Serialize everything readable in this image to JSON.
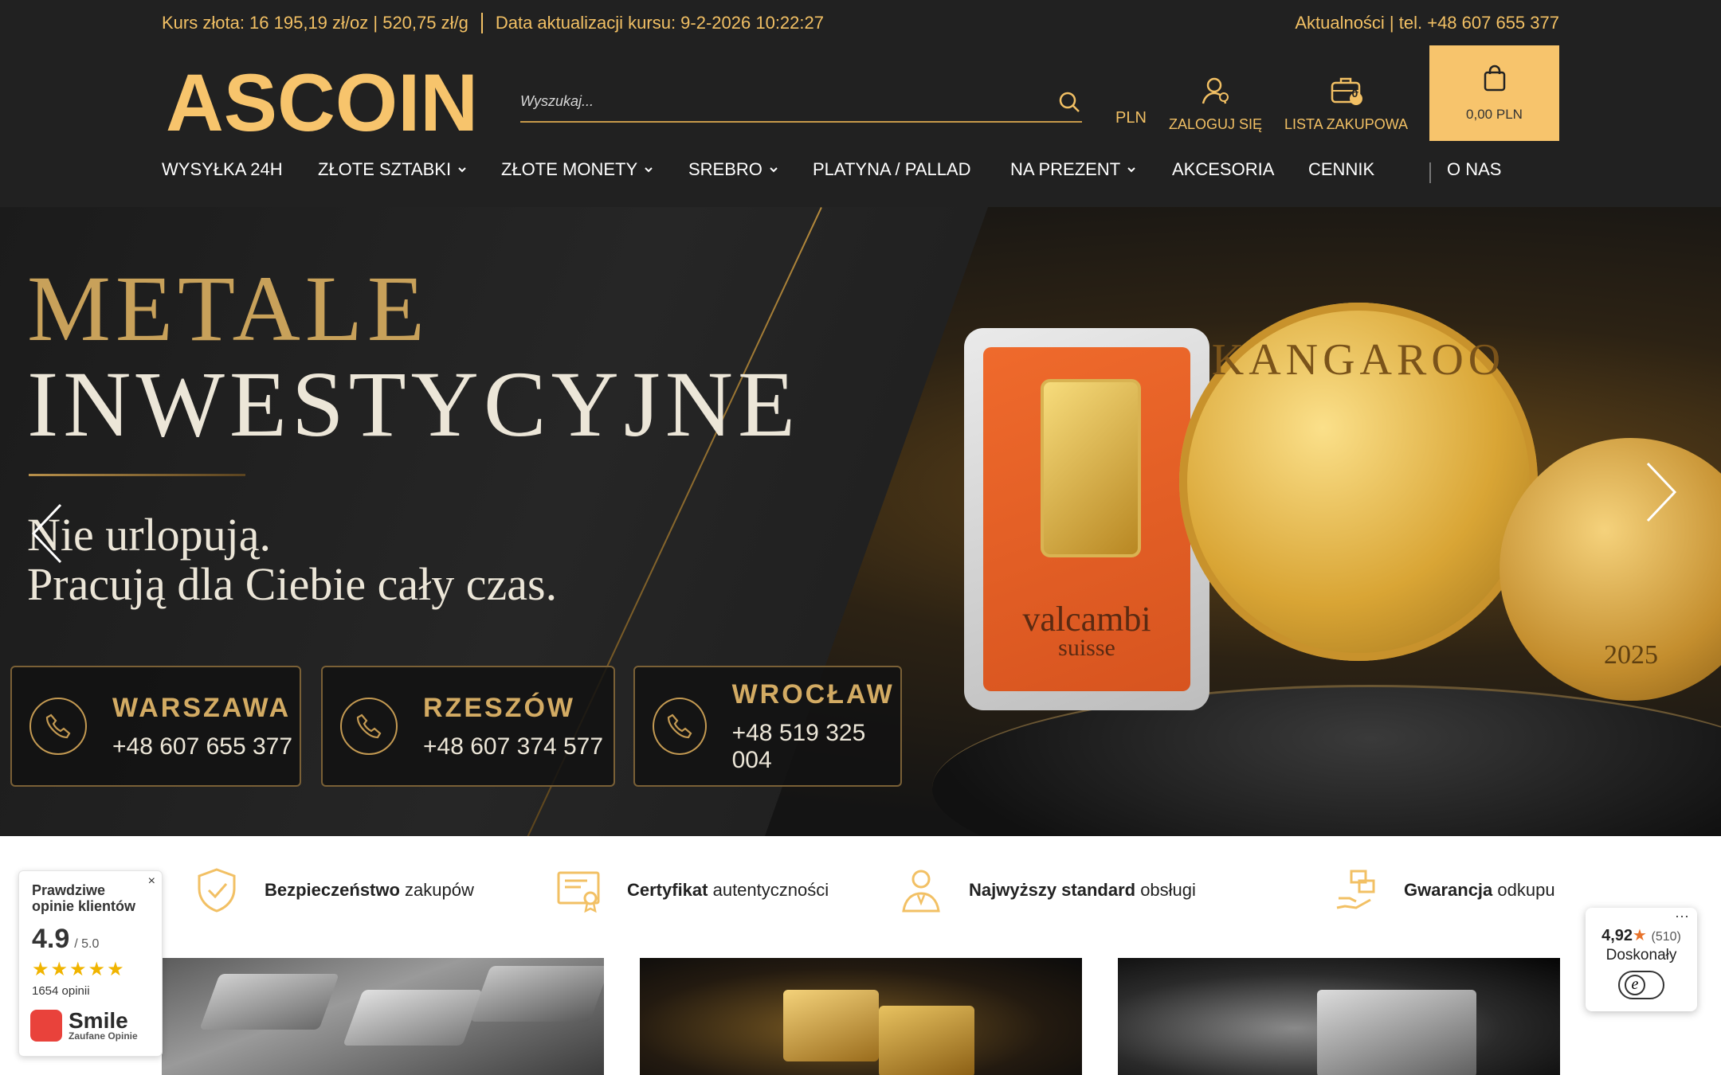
{
  "topbar": {
    "gold_rate": "Kurs złota: 16 195,19 zł/oz | 520,75 zł/g",
    "update_time": "Data aktualizacji kursu: 9-2-2026 10:22:27",
    "news_phone": "Aktualności | tel. +48 607 655 377"
  },
  "logo": {
    "text": "ASCOIN"
  },
  "search": {
    "placeholder": "Wyszukaj..."
  },
  "header": {
    "currency": "PLN",
    "login_label": "ZALOGUJ SIĘ",
    "wishlist_label": "LISTA ZAKUPOWA",
    "wishlist_count": "0",
    "cart_total": "0,00 PLN"
  },
  "nav": {
    "items": [
      {
        "label": "WYSYŁKA 24H"
      },
      {
        "label": "ZŁOTE SZTABKI"
      },
      {
        "label": "ZŁOTE MONETY"
      },
      {
        "label": "SREBRO"
      },
      {
        "label": "PLATYNA / PALLAD"
      },
      {
        "label": "NA PREZENT"
      },
      {
        "label": "AKCESORIA"
      },
      {
        "label": "CENNIK"
      },
      {
        "label": "O NAS"
      }
    ]
  },
  "hero": {
    "title_line1": "METALE",
    "title_line2": "INWESTYCYJNE",
    "subtitle_line1": "Nie urlopują.",
    "subtitle_line2": "Pracują dla Ciebie cały czas.",
    "offices": [
      {
        "city": "WARSZAWA",
        "phone": "+48 607 655 377"
      },
      {
        "city": "RZESZÓW",
        "phone": "+48 607 374 577"
      },
      {
        "city": "WROCŁAW",
        "phone": "+48 519 325 004"
      }
    ],
    "bar_brand": "valcambi",
    "bar_brand_sub": "suisse",
    "coin_label": "KANGAROO",
    "coin_year": "2025"
  },
  "features": [
    {
      "bold": "Bezpieczeństwo",
      "rest": " zakupów"
    },
    {
      "bold": "Certyfikat",
      "rest": " autentyczności"
    },
    {
      "bold": "Najwyższy standard",
      "rest": " obsługi"
    },
    {
      "bold": "Gwarancja",
      "rest": " odkupu"
    }
  ],
  "review_widget": {
    "close": "×",
    "title": "Prawdziwe opinie klientów",
    "score": "4.9",
    "scale": "/ 5.0",
    "stars": "★★★★★",
    "count": "1654 opinii",
    "brand": "Smile",
    "brand_sub": "Zaufane Opinie"
  },
  "trust_widget": {
    "dots": "···",
    "score": "4,92",
    "star": "★",
    "count": "(510)",
    "label": "Doskonały",
    "badge": "e"
  },
  "colors": {
    "accent": "#f2c064",
    "header_bg": "#212121",
    "cart_bg": "#f7c46c"
  }
}
